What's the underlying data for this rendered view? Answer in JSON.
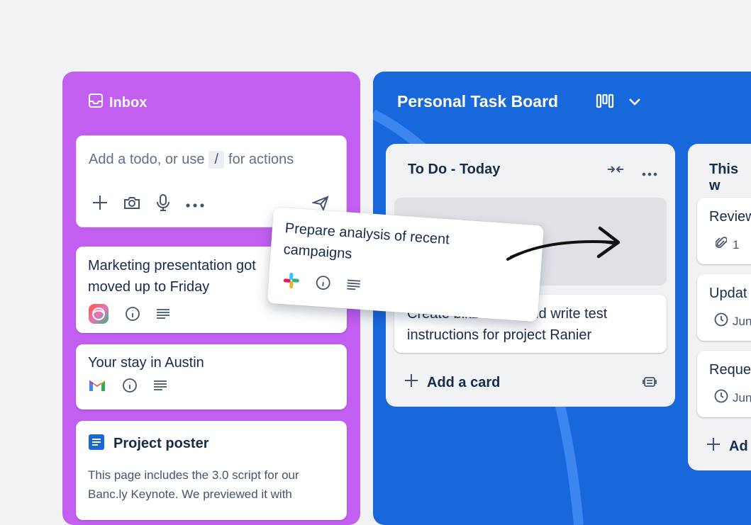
{
  "inbox": {
    "title": "Inbox",
    "add_placeholder_prefix": "Add a todo, or use",
    "add_placeholder_key": "/",
    "add_placeholder_suffix": "for actions",
    "cards": [
      {
        "title": "Marketing presentation got moved up to Friday",
        "source_icon": "atlassian-icon"
      },
      {
        "title": "Your stay in Austin",
        "source_icon": "gmail-icon"
      }
    ],
    "doc_card": {
      "title": "Project poster",
      "body": "This page includes the 3.0 script for our Banc.ly Keynote. We previewed it with"
    }
  },
  "board": {
    "title": "Personal Task Board",
    "lists": [
      {
        "title": "To Do - Today",
        "cards": [
          {
            "title": "Create blitz board and write test instructions for project Ranier"
          }
        ],
        "add_label": "Add a card"
      },
      {
        "title": "This w",
        "cards": [
          {
            "title": "Review",
            "attachments": "1"
          },
          {
            "title": "Updat",
            "date": "Jun"
          },
          {
            "title": "Reque",
            "date": "Jun"
          }
        ],
        "add_label": "Ad"
      }
    ]
  },
  "dragging_card": {
    "title": "Prepare analysis of recent campaigns",
    "source_icon": "slack-icon"
  },
  "colors": {
    "inbox_bg": "#c25ff0",
    "board_bg": "#1868db",
    "page_bg": "#f1f2f4"
  }
}
